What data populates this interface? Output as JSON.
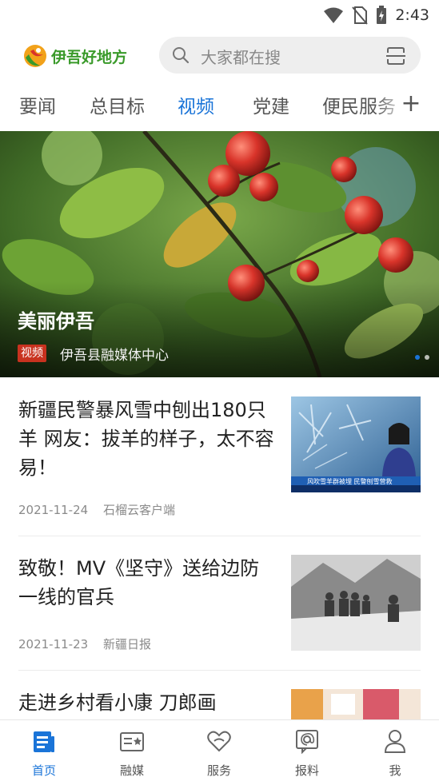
{
  "status": {
    "time": "2:43",
    "icons": [
      "wifi-icon",
      "no-sim-icon",
      "battery-charging-icon"
    ]
  },
  "header": {
    "logo_text": "伊吾好地方",
    "search_placeholder": "大家都在搜",
    "scan_icon": "scan-icon"
  },
  "tabs": [
    {
      "label": "要闻"
    },
    {
      "label": "总目标"
    },
    {
      "label": "视频",
      "active": true
    },
    {
      "label": "党建"
    },
    {
      "label": "便民服务"
    }
  ],
  "tab_add_label": "+",
  "hero": {
    "title": "美丽伊吾",
    "badge": "视频",
    "source": "伊吾县融媒体中心"
  },
  "news": [
    {
      "title": "新疆民警暴风雪中刨出180只羊 网友：拔羊的样子，太不容易！",
      "date": "2021-11-24",
      "source": "石榴云客户端",
      "thumb_caption": "风吹雪羊群被埋 民警刨雪营救"
    },
    {
      "title": "致敬！MV《坚守》送给边防一线的官兵",
      "date": "2021-11-23",
      "source": "新疆日报"
    },
    {
      "title": "走进乡村看小康 刀郎画"
    }
  ],
  "bottom_nav": [
    {
      "label": "首页",
      "icon": "home-doc-icon",
      "active": true
    },
    {
      "label": "融媒",
      "icon": "media-card-icon"
    },
    {
      "label": "服务",
      "icon": "heart-service-icon"
    },
    {
      "label": "报料",
      "icon": "report-at-icon"
    },
    {
      "label": "我",
      "icon": "user-icon"
    }
  ],
  "colors": {
    "accent": "#1a74d8",
    "badge": "#c8321f",
    "logo_green": "#3a9a2a"
  }
}
